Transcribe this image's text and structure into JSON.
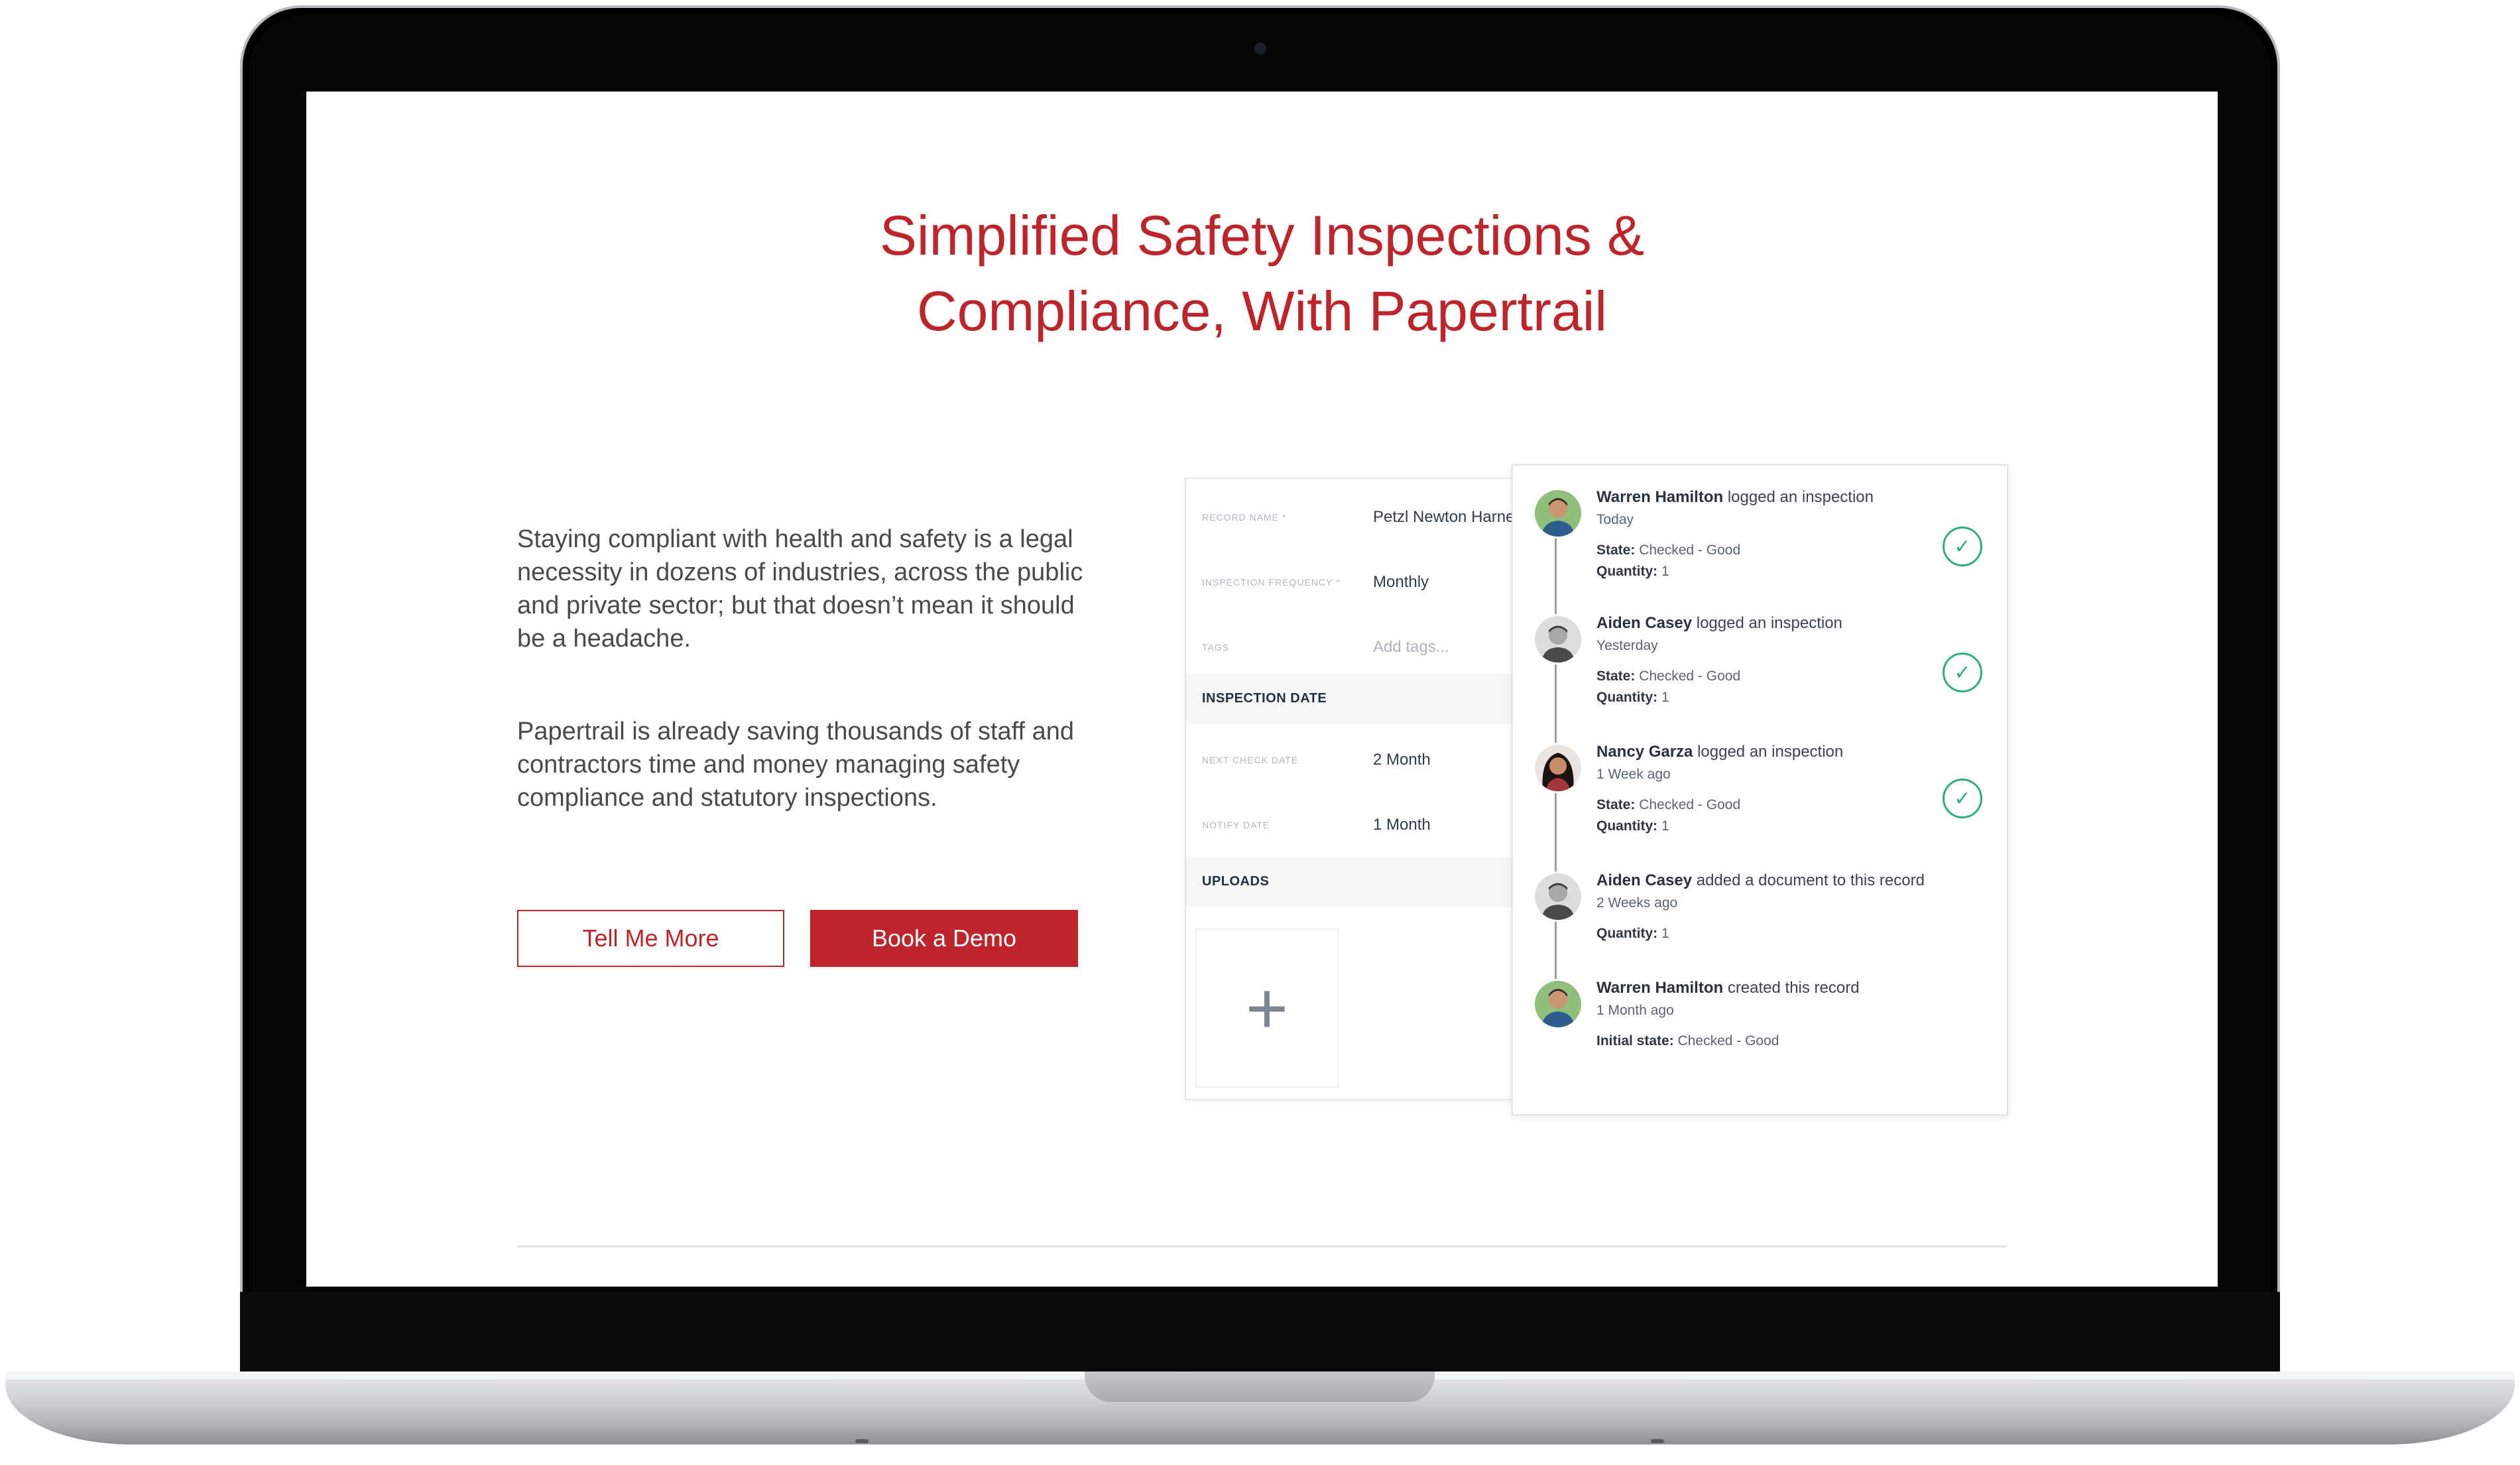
{
  "page": {
    "title_line1": "Simplified Safety Inspections &",
    "title_line2": "Compliance, With Papertrail",
    "paragraph1": "Staying compliant with health and safety is a legal necessity in dozens of industries, across the public and private sector; but that doesn’t mean it should be a headache.",
    "paragraph2": "Papertrail is already saving thousands of staff and contractors time and money managing safety compliance and statutory inspections.",
    "buttons": {
      "tell_more": "Tell Me More",
      "book_demo": "Book a Demo"
    }
  },
  "form": {
    "record_name_label": "RECORD NAME *",
    "record_name_value": "Petzl Newton Harness",
    "frequency_label": "INSPECTION FREQUENCY *",
    "frequency_value": "Monthly",
    "tags_label": "TAGS",
    "tags_placeholder": "Add tags...",
    "section_inspection_date": "INSPECTION DATE",
    "next_check_label": "NEXT CHECK DATE",
    "next_check_value": "2 Month",
    "notify_label": "NOTIFY DATE",
    "notify_value": "1 Month",
    "section_uploads": "UPLOADS",
    "upload_icon": "+"
  },
  "activity": [
    {
      "name": "Warren Hamilton",
      "action": "logged an inspection",
      "when": "Today",
      "state_label": "State:",
      "state": "Checked - Good",
      "qty_label": "Quantity:",
      "qty": "1",
      "checked": true
    },
    {
      "name": "Aiden Casey",
      "action": "logged an inspection",
      "when": "Yesterday",
      "state_label": "State:",
      "state": "Checked - Good",
      "qty_label": "Quantity:",
      "qty": "1",
      "checked": true
    },
    {
      "name": "Nancy Garza",
      "action": "logged an inspection",
      "when": "1 Week ago",
      "state_label": "State:",
      "state": "Checked - Good",
      "qty_label": "Quantity:",
      "qty": "1",
      "checked": true
    },
    {
      "name": "Aiden Casey",
      "action": "added a document to this record",
      "when": "2 Weeks ago",
      "qty_label": "Quantity:",
      "qty": "1",
      "checked": false
    },
    {
      "name": "Warren Hamilton",
      "action": "created this record",
      "when": "1 Month ago",
      "initial_label": "Initial state:",
      "initial": "Checked - Good",
      "checked": false
    }
  ],
  "check_glyph": "✓",
  "colors": {
    "brand_red": "#c0242b",
    "check_green": "#2cb07a",
    "navy_text": "#1f2f45"
  }
}
